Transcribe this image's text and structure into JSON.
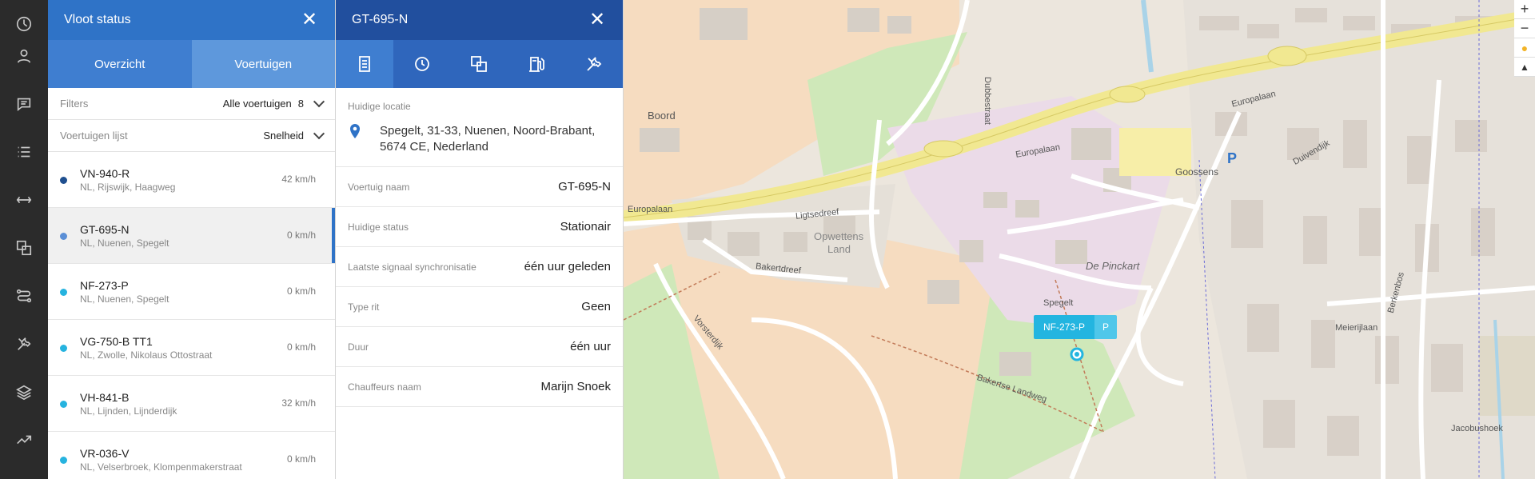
{
  "rail": {
    "icons": [
      "dashboard-icon",
      "user-icon",
      "chat-icon",
      "list-icon",
      "swap-icon",
      "translate-icon",
      "route-icon",
      "tools-icon",
      "layers-icon",
      "trend-icon"
    ]
  },
  "fleet": {
    "title": "Vloot status",
    "tabs": [
      "Overzicht",
      "Voertuigen"
    ],
    "filters_label": "Filters",
    "filters_value": "Alle voertuigen",
    "filters_count": "8",
    "list_label": "Voertuigen lijst",
    "sort_value": "Snelheid",
    "vehicles": [
      {
        "name": "VN-940-R",
        "location": "NL, Rijswijk, Haagweg",
        "speed": "42 km/h",
        "color": "#1f4f8f"
      },
      {
        "name": "GT-695-N",
        "location": "NL, Nuenen, Spegelt",
        "speed": "0 km/h",
        "color": "#5b8fd6"
      },
      {
        "name": "NF-273-P",
        "location": "NL, Nuenen, Spegelt",
        "speed": "0 km/h",
        "color": "#26b3df"
      },
      {
        "name": "VG-750-B TT1",
        "location": "NL, Zwolle, Nikolaus Ottostraat",
        "speed": "0 km/h",
        "color": "#26b3df"
      },
      {
        "name": "VH-841-B",
        "location": "NL, Lijnden, Lijnderdijk",
        "speed": "32 km/h",
        "color": "#26b3df"
      },
      {
        "name": "VR-036-V",
        "location": "NL, Velserbroek, Klompenmakerstraat",
        "speed": "0 km/h",
        "color": "#26b3df"
      }
    ]
  },
  "detail": {
    "title": "GT-695-N",
    "tab_icons": [
      "document-icon",
      "history-icon",
      "translate-icon",
      "fuel-icon",
      "tools-icon"
    ],
    "location_label": "Huidige locatie",
    "address_line1": "Spegelt, 31-33, Nuenen, Noord-Brabant,",
    "address_line2": "5674 CE, Nederland",
    "rows": [
      {
        "label": "Voertuig naam",
        "value": "GT-695-N"
      },
      {
        "label": "Huidige status",
        "value": "Stationair"
      },
      {
        "label": "Laatste signaal synchronisatie",
        "value": "één uur geleden"
      },
      {
        "label": "Type rit",
        "value": "Geen"
      },
      {
        "label": "Duur",
        "value": "één uur"
      },
      {
        "label": "Chauffeurs naam",
        "value": "Marijn Snoek"
      }
    ]
  },
  "map": {
    "labels": {
      "boord": "Boord",
      "europalaan": "Europalaan",
      "europalaan2": "Europalaan",
      "europalaan3": "Europalaan",
      "lijtsedreef": "Ligtsedreef",
      "opwettens": "Opwettens",
      "land": "Land",
      "bakertdreef": "Bakertdreef",
      "dubbestraat": "Dubbestraat",
      "de_pinckart": "De Pinckart",
      "goossens": "Goossens",
      "spegelt": "Spegelt",
      "vorsterdijk": "Vorsterdijk",
      "bakertse_landweg": "Bakertse Landweg",
      "duivendijk": "Duivendijk",
      "meierijlaan": "Meierijlaan",
      "berkenbos": "Berkenbos",
      "jacobushoek": "Jacobushoek",
      "parking": "P"
    },
    "vehicle_id": "NF-273-P",
    "vehicle_badge": "P",
    "zoom_in": "+",
    "zoom_out": "−",
    "compass": "▲"
  }
}
